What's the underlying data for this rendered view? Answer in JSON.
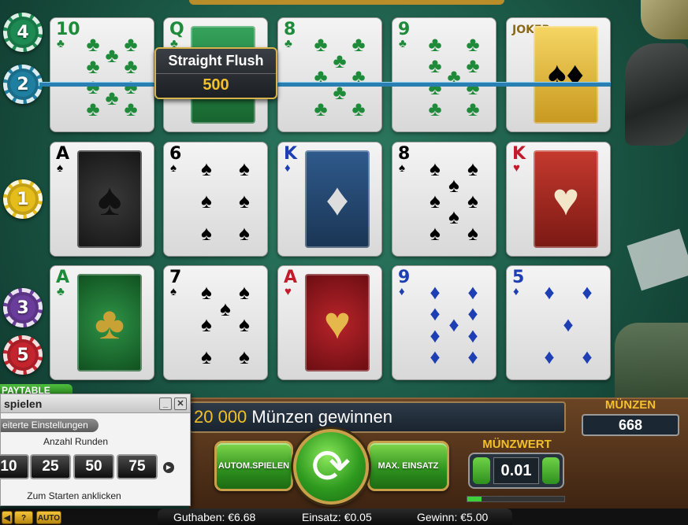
{
  "tooltip": {
    "title": "Straight Flush",
    "value": "500"
  },
  "chips": {
    "left_top": "4",
    "left_line": "2",
    "left_mid": "1",
    "left_lower": "3",
    "left_bottom": "5"
  },
  "cards": {
    "row1": [
      {
        "rank": "10",
        "suit": "♣",
        "suit_name": "clubs"
      },
      {
        "rank": "Q",
        "suit": "♣",
        "suit_name": "clubs"
      },
      {
        "rank": "8",
        "suit": "♣",
        "suit_name": "clubs"
      },
      {
        "rank": "9",
        "suit": "♣",
        "suit_name": "clubs"
      },
      {
        "rank": "JOKER",
        "suit": "",
        "suit_name": "joker"
      }
    ],
    "row2": [
      {
        "rank": "A",
        "suit": "♠",
        "suit_name": "spades"
      },
      {
        "rank": "6",
        "suit": "♠",
        "suit_name": "spades"
      },
      {
        "rank": "K",
        "suit": "♦",
        "suit_name": "diamonds"
      },
      {
        "rank": "8",
        "suit": "♠",
        "suit_name": "spades"
      },
      {
        "rank": "K",
        "suit": "♥",
        "suit_name": "hearts"
      }
    ],
    "row3": [
      {
        "rank": "A",
        "suit": "♣",
        "suit_name": "clubs"
      },
      {
        "rank": "7",
        "suit": "♠",
        "suit_name": "spades"
      },
      {
        "rank": "A",
        "suit": "♥",
        "suit_name": "hearts"
      },
      {
        "rank": "9",
        "suit": "♦",
        "suit_name": "diamonds"
      },
      {
        "rank": "5",
        "suit": "♦",
        "suit_name": "diamonds"
      }
    ]
  },
  "paytable_tab": "PAYTABLE",
  "autoplay_window": {
    "title": "spielen",
    "minimize": "_",
    "close": "✕",
    "advanced": "eiterte Einstellungen",
    "rounds_label": "Anzahl Runden",
    "rounds": [
      "10",
      "25",
      "50",
      "75"
    ],
    "start_hint": "Zum Starten anklicken"
  },
  "message": {
    "amount": "20 000",
    "text": " Münzen gewinnen"
  },
  "coins": {
    "label": "MÜNZEN",
    "value": "668"
  },
  "buttons": {
    "autoplay": "AUTOM.SPIELEN",
    "max_bet": "MAX. EINSATZ"
  },
  "coin_value": {
    "label": "MÜNZWERT",
    "value": "0.01",
    "level_fraction": 0.15
  },
  "status": {
    "balance": "Guthaben: €6.68",
    "bet": "Einsatz: €0.05",
    "win": "Gewinn: €5.00"
  },
  "mini_buttons": {
    "help": "?",
    "auto": "AUTO"
  },
  "colors": {
    "felt": "#1d5c49",
    "gold": "#f3c02b",
    "payline": "#2a7fb2",
    "clubs": "#1e8a3a",
    "diamonds": "#1d3fb3",
    "hearts": "#c41b2a"
  }
}
